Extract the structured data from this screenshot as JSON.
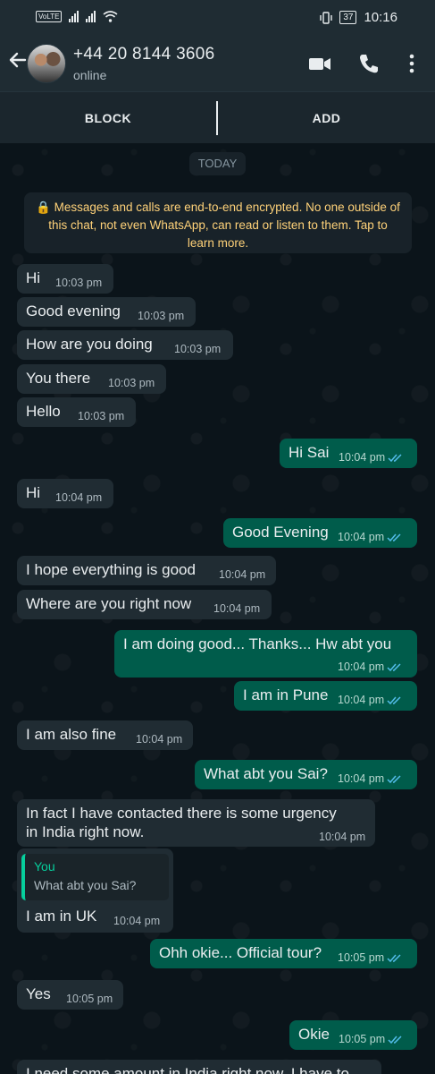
{
  "status_bar": {
    "carrier_badge": "VoLTE",
    "time": "10:16",
    "battery": "37"
  },
  "header": {
    "contact": "+44 20 8144 3606",
    "status": "online",
    "icons": [
      "back-arrow-icon",
      "video-call-icon",
      "phone-icon",
      "more-options-icon"
    ]
  },
  "actions": {
    "block": "BLOCK",
    "add": "ADD"
  },
  "chat": {
    "date_chip": "TODAY",
    "encryption_notice": "🔒 Messages and calls are end-to-end encrypted. No one outside of this chat, not even WhatsApp, can read or listen to them. Tap to learn more.",
    "messages": [
      {
        "dir": "in",
        "text": "Hi",
        "time": "10:03 pm"
      },
      {
        "dir": "in",
        "text": "Good evening",
        "time": "10:03 pm"
      },
      {
        "dir": "in",
        "text": "How are you doing",
        "time": "10:03 pm"
      },
      {
        "dir": "in",
        "text": "You there",
        "time": "10:03 pm"
      },
      {
        "dir": "in",
        "text": "Hello",
        "time": "10:03 pm"
      },
      {
        "dir": "out",
        "text": "Hi Sai",
        "time": "10:04 pm"
      },
      {
        "dir": "in",
        "text": "Hi",
        "time": "10:04 pm"
      },
      {
        "dir": "out",
        "text": "Good Evening",
        "time": "10:04 pm"
      },
      {
        "dir": "in",
        "text": "I hope everything is good",
        "time": "10:04 pm"
      },
      {
        "dir": "in",
        "text": "Where are you right now",
        "time": "10:04 pm"
      },
      {
        "dir": "out",
        "text": "I am doing good... Thanks... Hw abt you",
        "time": "10:04 pm"
      },
      {
        "dir": "out",
        "text": "I am in Pune",
        "time": "10:04 pm"
      },
      {
        "dir": "in",
        "text": "I am also fine",
        "time": "10:04 pm"
      },
      {
        "dir": "out",
        "text": "What abt you Sai?",
        "time": "10:04 pm"
      },
      {
        "dir": "in",
        "text_line1": "In fact I have contacted there is some urgency",
        "text_line2": "in India right now.",
        "time": "10:04 pm"
      },
      {
        "dir": "in",
        "quote_author": "You",
        "quote_text": "What abt you Sai?",
        "text": "I am in UK",
        "time": "10:04 pm"
      },
      {
        "dir": "out",
        "text": "Ohh okie... Official tour?",
        "time": "10:05 pm"
      },
      {
        "dir": "in",
        "text": "Yes",
        "time": "10:05 pm"
      },
      {
        "dir": "out",
        "text": "Okie",
        "time": "10:05 pm"
      },
      {
        "dir": "in",
        "text": "I need some amount in India right now. I have to"
      }
    ]
  }
}
